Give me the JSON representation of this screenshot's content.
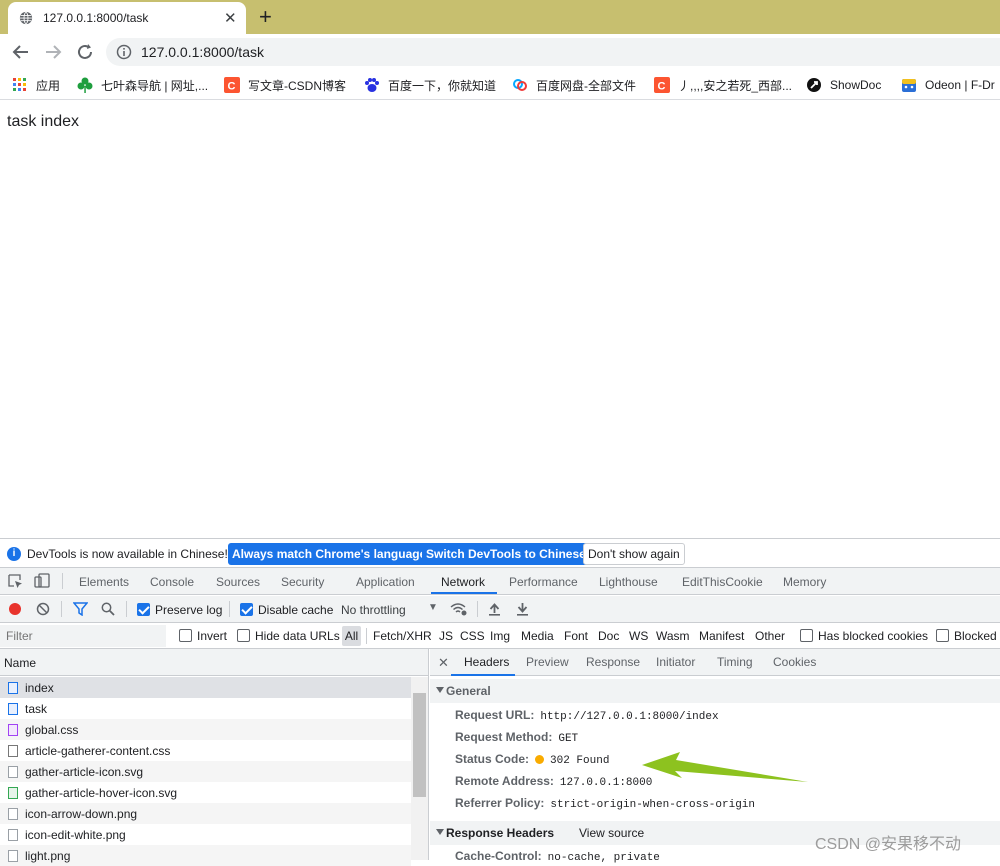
{
  "browser": {
    "tab_title": "127.0.0.1:8000/task",
    "url": "127.0.0.1:8000/task",
    "bookmarks": [
      "应用",
      "七叶森导航 | 网址,...",
      "写文章-CSDN博客",
      "百度一下，你就知道",
      "百度网盘-全部文件",
      "丿,,,,安之若死_西部...",
      "ShowDoc",
      "Odeon | F-Dr"
    ]
  },
  "page": {
    "text": "task index"
  },
  "devtools": {
    "banner": {
      "message": "DevTools is now available in Chinese!",
      "btn_match": "Always match Chrome's language",
      "btn_switch": "Switch DevTools to Chinese",
      "btn_dismiss": "Don't show again"
    },
    "tabs": [
      "Elements",
      "Console",
      "Sources",
      "Security",
      "Application",
      "Network",
      "Performance",
      "Lighthouse",
      "EditThisCookie",
      "Memory"
    ],
    "toolbar": {
      "preserve_log": "Preserve log",
      "disable_cache": "Disable cache",
      "throttling": "No throttling"
    },
    "filter": {
      "placeholder": "Filter",
      "invert": "Invert",
      "hide_data_urls": "Hide data URLs",
      "types": [
        "All",
        "Fetch/XHR",
        "JS",
        "CSS",
        "Img",
        "Media",
        "Font",
        "Doc",
        "WS",
        "Wasm",
        "Manifest",
        "Other"
      ],
      "has_blocked_cookies": "Has blocked cookies",
      "blocked": "Blocked"
    },
    "requests": {
      "header": "Name",
      "items": [
        "index",
        "task",
        "global.css",
        "article-gatherer-content.css",
        "gather-article-icon.svg",
        "gather-article-hover-icon.svg",
        "icon-arrow-down.png",
        "icon-edit-white.png",
        "light.png"
      ]
    },
    "details": {
      "tabs": [
        "Headers",
        "Preview",
        "Response",
        "Initiator",
        "Timing",
        "Cookies"
      ],
      "general_title": "General",
      "general": [
        {
          "key": "Request URL:",
          "value": "http://127.0.0.1:8000/index"
        },
        {
          "key": "Request Method:",
          "value": "GET"
        },
        {
          "key": "Status Code:",
          "value": "302 Found"
        },
        {
          "key": "Remote Address:",
          "value": "127.0.0.1:8000"
        },
        {
          "key": "Referrer Policy:",
          "value": "strict-origin-when-cross-origin"
        }
      ],
      "response_headers_title": "Response Headers",
      "view_source": "View source",
      "response_first": {
        "key": "Cache-Control:",
        "value": "no-cache, private"
      }
    }
  },
  "watermark": "CSDN @安果移不动",
  "colors": {
    "accent": "#1a73e8",
    "status_dot": "#f9ab00",
    "arrow": "#8dc21f",
    "tabstrip": "#c7bf6f"
  }
}
